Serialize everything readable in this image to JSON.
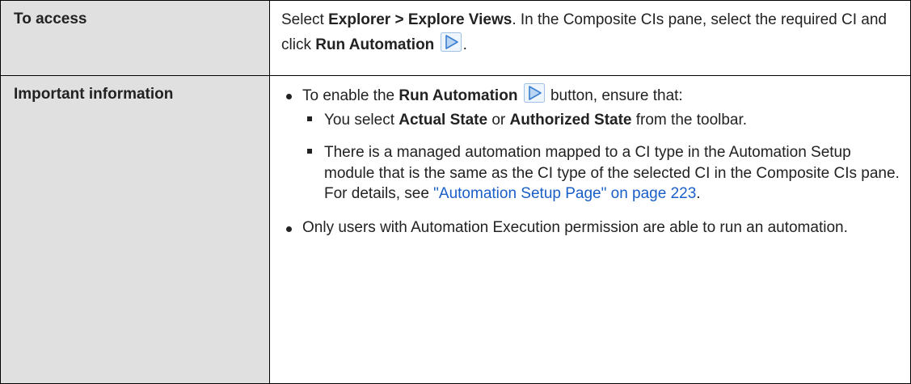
{
  "table": {
    "access": {
      "heading": "To access",
      "t1": "Select ",
      "b1": "Explorer > Explore Views",
      "t2": ". In the Composite CIs pane, select the required CI and click ",
      "b2": "Run Automation",
      "t3": ".",
      "icon": "run-automation-icon"
    },
    "info": {
      "heading": "Important information",
      "bullet1": {
        "t1": "To enable the ",
        "b1": "Run Automation",
        "t2": " button, ensure that:",
        "icon": "run-automation-icon",
        "sub1": {
          "t1": "You select ",
          "b1": "Actual State",
          "t2": " or ",
          "b2": "Authorized State",
          "t3": " from the toolbar."
        },
        "sub2": {
          "t1": "There is a managed automation mapped to a CI type in the Automation Setup module that is the same as the CI type of the selected CI in the Composite CIs pane. For details, see ",
          "link": "\"Automation Setup Page\" on page 223",
          "t2": "."
        }
      },
      "bullet2": "Only users with Automation Execution permission are able to run an automation."
    }
  },
  "colors": {
    "header_bg": "#e0e0e0",
    "border": "#000000",
    "link": "#1a5ec8",
    "icon_fill": "#b9d5f2",
    "icon_stroke": "#3b7fd0"
  }
}
